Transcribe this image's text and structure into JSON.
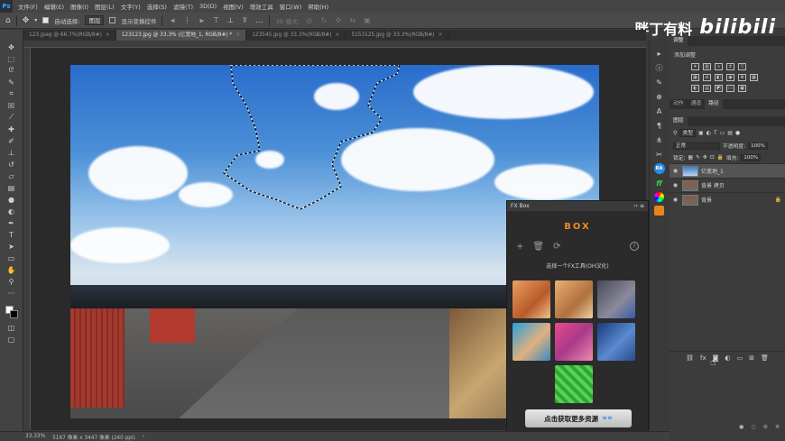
{
  "menu": {
    "app_icon": "Ps",
    "items": [
      "文件(F)",
      "编辑(E)",
      "图像(I)",
      "图层(L)",
      "文字(Y)",
      "选择(S)",
      "滤镜(T)",
      "3D(D)",
      "视图(V)",
      "增效工具",
      "窗口(W)",
      "帮助(H)"
    ]
  },
  "options_bar": {
    "home_icon": "home-icon",
    "auto_select_label": "自动选择:",
    "auto_select_value": "图层",
    "show_transform_label": "显示变换控件",
    "mode_label": "3D 模式:"
  },
  "watermark": {
    "text": "胖丁有料",
    "logo": "bilibili"
  },
  "tabs": [
    {
      "label": "123.jpeg @ 66.7%(RGB/8#)",
      "active": false
    },
    {
      "label": "123123.jpg @ 33.3% (亿宽地_1, RGB/8#) *",
      "active": true
    },
    {
      "label": "123545.jpg @ 33.3%(RGB/8#)",
      "active": false
    },
    {
      "label": "5153125.jpg @ 33.3%(RGB/8#)",
      "active": false
    }
  ],
  "fxbox": {
    "title": "FX Box",
    "logo": "BOX",
    "hint": "选择一个FX工具(OH汉化)",
    "cta": "点击获取更多资源",
    "thumbs": [
      {
        "name": "watercolor-thumb",
        "color": "#d97a3a"
      },
      {
        "name": "fox-art-thumb",
        "color": "#c88a4a"
      },
      {
        "name": "house-3d-thumb",
        "color": "#6a6a7a"
      },
      {
        "name": "sunglasses-thumb",
        "color": "#3aa0c8"
      },
      {
        "name": "neon-portrait-thumb",
        "color": "#b84a8a"
      },
      {
        "name": "sketch-portrait-thumb",
        "color": "#3a6aa8"
      },
      {
        "name": "green-texture-thumb",
        "color": "#3aa83a"
      }
    ]
  },
  "adjustments": {
    "tab": "调整",
    "title": "添加调整"
  },
  "layers_panel": {
    "tabs": [
      "动作",
      "通道",
      "路径"
    ],
    "active_tab": "图层",
    "filter_label": "类型",
    "blend_mode": "正常",
    "opacity_label": "不透明度:",
    "opacity_value": "100%",
    "lock_label": "锁定:",
    "fill_label": "填充:",
    "fill_value": "100%",
    "layers": [
      {
        "name": "亿宽地_1",
        "selected": true,
        "locked": false
      },
      {
        "name": "背景 拷贝",
        "selected": false,
        "locked": false
      },
      {
        "name": "背景",
        "selected": false,
        "locked": true
      }
    ]
  },
  "status": {
    "zoom": "33.33%",
    "doc_info": "5167 像素 x 3447 像素 (240 ppi)"
  }
}
